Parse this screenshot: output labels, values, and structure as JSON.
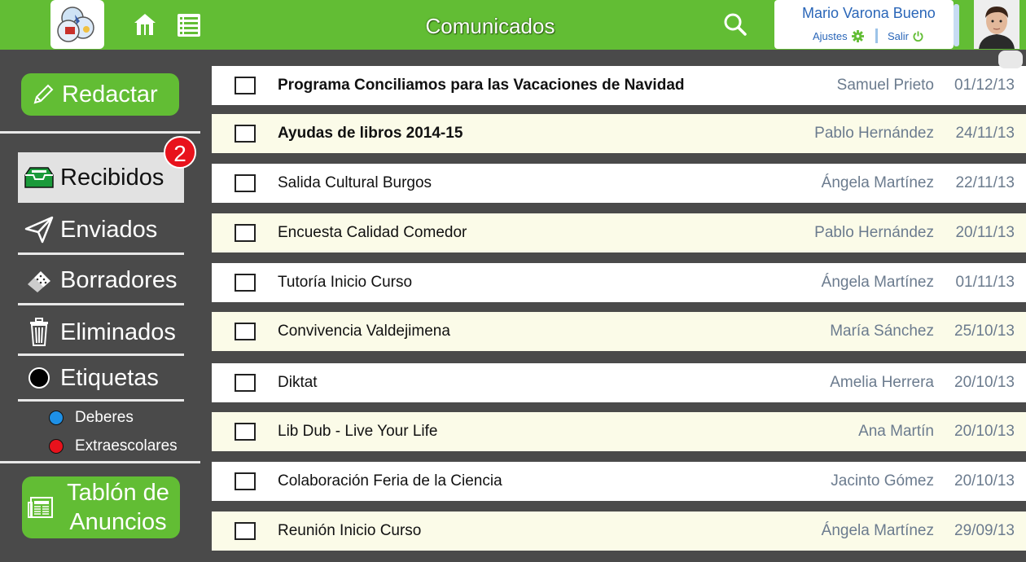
{
  "header": {
    "title": "Comunicados",
    "user_name": "Mario Varona Bueno",
    "settings_label": "Ajustes",
    "logout_label": "Salir"
  },
  "sidebar": {
    "compose_label": "Redactar",
    "unread_count": "2",
    "items": [
      {
        "label": "Recibidos",
        "icon": "inbox-tray-icon"
      },
      {
        "label": "Enviados",
        "icon": "paper-plane-icon"
      },
      {
        "label": "Borradores",
        "icon": "eraser-icon"
      },
      {
        "label": "Eliminados",
        "icon": "trash-icon"
      },
      {
        "label": "Etiquetas",
        "icon": "tag-circle-icon"
      }
    ],
    "tags": [
      {
        "label": "Deberes",
        "color": "#1e90e6"
      },
      {
        "label": "Extraescolares",
        "color": "#e8121c"
      }
    ],
    "board_label_line1": "Tablón de",
    "board_label_line2": "Anuncios"
  },
  "messages": [
    {
      "subject": "Programa Conciliamos para las Vacaciones de Navidad",
      "sender": "Samuel Prieto",
      "date": "01/12/13",
      "unread": true
    },
    {
      "subject": "Ayudas de libros 2014-15",
      "sender": "Pablo Hernández",
      "date": "24/11/13",
      "unread": true
    },
    {
      "subject": "Salida Cultural Burgos",
      "sender": "Ángela Martínez",
      "date": "22/11/13",
      "unread": false
    },
    {
      "subject": "Encuesta Calidad Comedor",
      "sender": "Pablo Hernández",
      "date": "20/11/13",
      "unread": false
    },
    {
      "subject": "Tutoría Inicio Curso",
      "sender": "Ángela Martínez",
      "date": "01/11/13",
      "unread": false
    },
    {
      "subject": "Convivencia Valdejimena",
      "sender": "María Sánchez",
      "date": "25/10/13",
      "unread": false
    },
    {
      "subject": "Diktat",
      "sender": "Amelia Herrera",
      "date": "20/10/13",
      "unread": false
    },
    {
      "subject": "Lib Dub - Live Your Life",
      "sender": "Ana Martín",
      "date": "20/10/13",
      "unread": false
    },
    {
      "subject": "Colaboración Feria de la Ciencia",
      "sender": "Jacinto Gómez",
      "date": "20/10/13",
      "unread": false
    },
    {
      "subject": "Reunión Inicio Curso",
      "sender": "Ángela Martínez",
      "date": "29/09/13",
      "unread": false
    }
  ]
}
